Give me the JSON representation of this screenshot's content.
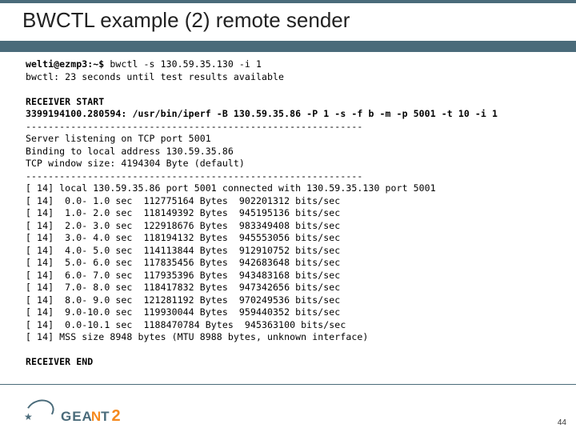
{
  "slide": {
    "title": "BWCTL example (2) remote sender",
    "page_number": "44"
  },
  "logo": {
    "name_main": "GEA",
    "name_n": "N",
    "name_t": "T",
    "suffix": "2"
  },
  "terminal": {
    "cmd_prompt": "welti@ezmp3:~$",
    "cmd_text": " bwctl -s 130.59.35.130 -i 1",
    "wait_line": "bwctl: 23 seconds until test results available",
    "recv_start": "RECEIVER START",
    "recv_end": "RECEIVER END",
    "header_line": "3399194100.280594: /usr/bin/iperf -B 130.59.35.86 -P 1 -s -f b -m -p 5001 -t 10 -i 1",
    "dash_line": "------------------------------------------------------------",
    "server_listen": "Server listening on TCP port 5001",
    "binding": "Binding to local address 130.59.35.86",
    "tcp_window": "TCP window size: 4194304 Byte (default)",
    "conn_line": "[ 14] local 130.59.35.86 port 5001 connected with 130.59.35.130 port 5001",
    "rows": [
      "[ 14]  0.0- 1.0 sec  112775164 Bytes  902201312 bits/sec",
      "[ 14]  1.0- 2.0 sec  118149392 Bytes  945195136 bits/sec",
      "[ 14]  2.0- 3.0 sec  122918676 Bytes  983349408 bits/sec",
      "[ 14]  3.0- 4.0 sec  118194132 Bytes  945553056 bits/sec",
      "[ 14]  4.0- 5.0 sec  114113844 Bytes  912910752 bits/sec",
      "[ 14]  5.0- 6.0 sec  117835456 Bytes  942683648 bits/sec",
      "[ 14]  6.0- 7.0 sec  117935396 Bytes  943483168 bits/sec",
      "[ 14]  7.0- 8.0 sec  118417832 Bytes  947342656 bits/sec",
      "[ 14]  8.0- 9.0 sec  121281192 Bytes  970249536 bits/sec",
      "[ 14]  9.0-10.0 sec  119930044 Bytes  959440352 bits/sec",
      "[ 14]  0.0-10.1 sec  1188470784 Bytes  945363100 bits/sec"
    ],
    "mss_line": "[ 14] MSS size 8948 bytes (MTU 8988 bytes, unknown interface)"
  }
}
